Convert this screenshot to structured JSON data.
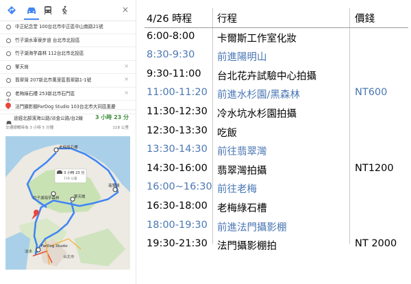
{
  "colors": {
    "move": "#4a77b4",
    "text": "#000000",
    "route": "#4285f4",
    "duration": "#3c8c3c"
  },
  "directions": {
    "modes": [
      "directions-icon",
      "car-icon",
      "transit-icon",
      "walk-icon"
    ],
    "close": "×",
    "stops": [
      {
        "label": "中正紀念堂 100台北市中正區中山南路21號",
        "removable": false,
        "last": false
      },
      {
        "label": "竹子湖水車寮步道 台北市北投區",
        "removable": false,
        "last": false
      },
      {
        "label": "竹子湖海芋森林 112台北市北投區",
        "removable": false,
        "last": false
      },
      {
        "label": "擎天崗",
        "removable": true,
        "last": false
      },
      {
        "label": "翡翠灣 207新北市萬里區翡翠路1-1號",
        "removable": true,
        "last": false
      },
      {
        "label": "老梅綠石槽 253新北市石門區",
        "removable": true,
        "last": false
      },
      {
        "label": "法門攝影棚FarDog Studio 103台北市大同區重慶",
        "removable": false,
        "last": true
      }
    ],
    "add": "+",
    "route": {
      "desc": "途經北部濱海公路/淡金公路/台2線",
      "time": "3 小時 23 分",
      "sub": "交通順暢時為 3 小時 5 分鐘",
      "distance": "118 公里"
    },
    "map": {
      "bubble_time": "3 小時 23 分",
      "bubble_dist": "118 公里",
      "places": {
        "laomei": "老梅綠石槽",
        "jadebay": "翡翠灣",
        "bamboo_forest": "竹子湖海芋森林",
        "qingtian": "擎天崗",
        "studio": "FarDog Studio",
        "tamsui": "淡水",
        "taipei": "台北市"
      }
    }
  },
  "schedule": {
    "header": {
      "time": "4/26 時程",
      "activity": "行程",
      "price": "價錢"
    },
    "rows": [
      {
        "time": "6:00-8:00",
        "activity": "卡爾斯工作室化妝",
        "price": "",
        "move": false
      },
      {
        "time": "8:30-9:30",
        "activity": "前進陽明山",
        "price": "",
        "move": true
      },
      {
        "time": "9:30-11:00",
        "activity": "台北花卉試驗中心拍攝",
        "price": "",
        "move": false
      },
      {
        "time": "11:00-11:20",
        "activity": "前進水杉園/黑森林",
        "price": "NT600",
        "move": true
      },
      {
        "time": "11:30-12:30",
        "activity": "冷水坑水杉園拍攝",
        "price": "",
        "move": false
      },
      {
        "time": "12:30-13:30",
        "activity": "吃飯",
        "price": "",
        "move": false
      },
      {
        "time": "13:30-14:30",
        "activity": "前往翡翠灣",
        "price": "",
        "move": true
      },
      {
        "time": "14:30-16:00",
        "activity": "翡翠灣拍攝",
        "price": "NT1200",
        "move": false
      },
      {
        "time": "16:00~16:30",
        "activity": "前往老梅",
        "price": "",
        "move": true
      },
      {
        "time": "16:30-18:00",
        "activity": "老梅綠石槽",
        "price": "",
        "move": false
      },
      {
        "time": "18:00-19:30",
        "activity": "前進法門攝影棚",
        "price": "",
        "move": true
      },
      {
        "time": "19:30-21:30",
        "activity": "法門攝影棚拍",
        "price": "NT 2000",
        "move": false
      }
    ]
  }
}
